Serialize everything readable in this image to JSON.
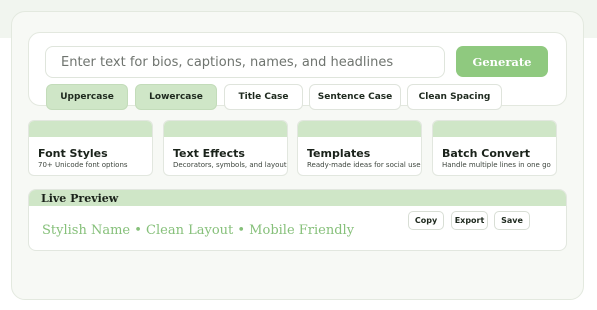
{
  "input": {
    "placeholder": "Enter text for bios, captions, names, and headlines",
    "value": ""
  },
  "generate_label": "Generate",
  "case_buttons": [
    {
      "label": "Uppercase",
      "active": true
    },
    {
      "label": "Lowercase",
      "active": true
    },
    {
      "label": "Title Case",
      "active": false
    },
    {
      "label": "Sentence Case",
      "active": false
    },
    {
      "label": "Clean Spacing",
      "active": false
    }
  ],
  "tool_cards": [
    {
      "title": "Font Styles",
      "description": "70+ Unicode font options"
    },
    {
      "title": "Text Effects",
      "description": "Decorators, symbols, and layout tools"
    },
    {
      "title": "Templates",
      "description": "Ready-made ideas for social use"
    },
    {
      "title": "Batch Convert",
      "description": "Handle multiple lines in one go"
    }
  ],
  "preview": {
    "title": "Live Preview",
    "text": "Stylish Name • Clean Layout • Mobile Friendly",
    "actions": [
      "Copy",
      "Export",
      "Save"
    ]
  },
  "colors": {
    "accent": "#8fc97f",
    "accent_light": "#cfe6c7",
    "preview_text": "#86c07a"
  }
}
